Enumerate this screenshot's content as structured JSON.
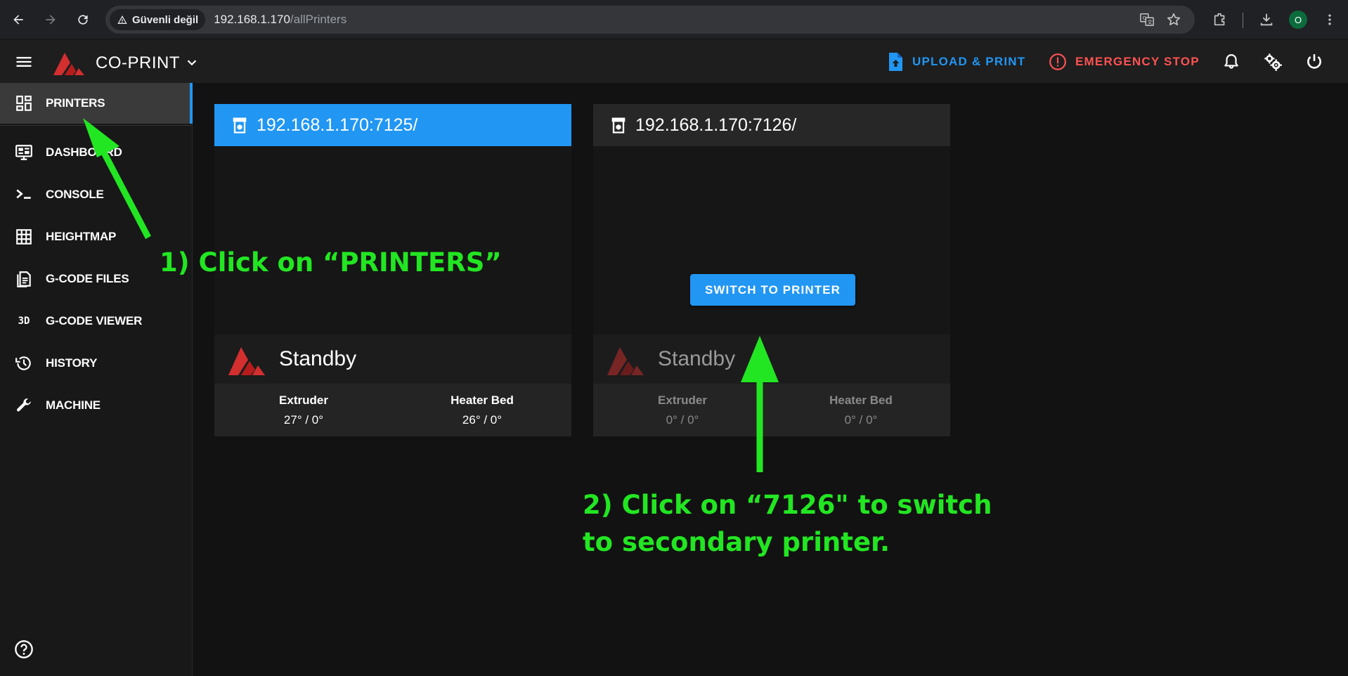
{
  "browser": {
    "security_label": "Güvenli değil",
    "url_host": "192.168.1.170",
    "url_path": "/allPrinters",
    "profile_initial": "O"
  },
  "app": {
    "title": "CO-PRINT",
    "upload_label": "UPLOAD & PRINT",
    "estop_label": "EMERGENCY STOP",
    "accent_color": "#2196f3",
    "estop_color": "#ff5252"
  },
  "sidebar": {
    "items": [
      {
        "label": "PRINTERS",
        "icon": "view-dashboard-icon"
      },
      {
        "label": "DASHBOARD",
        "icon": "monitor-dashboard-icon"
      },
      {
        "label": "CONSOLE",
        "icon": "console-icon"
      },
      {
        "label": "HEIGHTMAP",
        "icon": "grid-icon"
      },
      {
        "label": "G-CODE FILES",
        "icon": "file-document-icon"
      },
      {
        "label": "G-CODE VIEWER",
        "icon": "3d-icon"
      },
      {
        "label": "HISTORY",
        "icon": "history-icon"
      },
      {
        "label": "MACHINE",
        "icon": "wrench-icon"
      }
    ]
  },
  "printers": [
    {
      "title": "192.168.1.170:7125/",
      "status": "Standby",
      "extruder_label": "Extruder",
      "extruder_value": "27° / 0°",
      "bed_label": "Heater Bed",
      "bed_value": "26° / 0°"
    },
    {
      "title": "192.168.1.170:7126/",
      "status": "Standby",
      "switch_label": "SWITCH TO PRINTER",
      "extruder_label": "Extruder",
      "extruder_value": "0° / 0°",
      "bed_label": "Heater Bed",
      "bed_value": "0° / 0°"
    }
  ],
  "annotations": {
    "step1": "1) Click on “PRINTERS”",
    "step2_line1": "2) Click on “7126\" to switch",
    "step2_line2": "to secondary printer.",
    "color": "#22e622"
  }
}
